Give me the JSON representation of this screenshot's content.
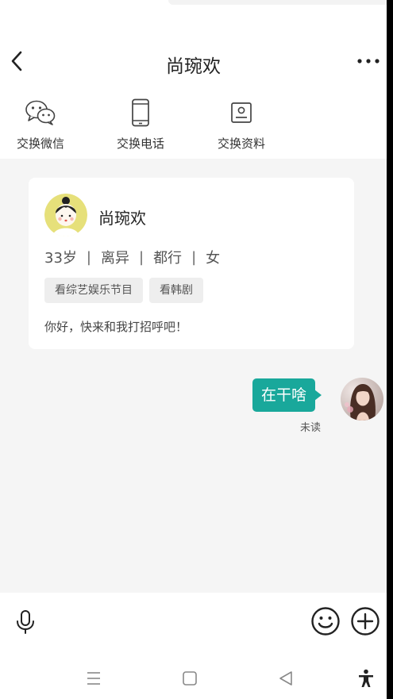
{
  "header": {
    "title": "尚琬欢",
    "back_icon": "chevron-left-icon",
    "more_icon": "more-dots-icon"
  },
  "actions": [
    {
      "label": "交换微信",
      "icon": "wechat-icon"
    },
    {
      "label": "交换电话",
      "icon": "phone-icon"
    },
    {
      "label": "交换资料",
      "icon": "profile-card-icon"
    }
  ],
  "profile_card": {
    "name": "尚琬欢",
    "age": "33岁",
    "marital": "离异",
    "city": "都行",
    "gender": "女",
    "tags": [
      "看综艺娱乐节目",
      "看韩剧"
    ],
    "greeting": "你好，快来和我打招呼吧！",
    "avatar_bg": "#e6e07a"
  },
  "message": {
    "text": "在干啥",
    "status": "未读",
    "bubble_color": "#19a89b"
  },
  "input_bar": {
    "mic_icon": "microphone-icon",
    "emoji_icon": "emoji-icon",
    "plus_icon": "plus-circle-icon"
  },
  "nav": {
    "icons": [
      "menu-icon",
      "home-icon",
      "back-triangle-icon",
      "accessibility-icon"
    ]
  }
}
